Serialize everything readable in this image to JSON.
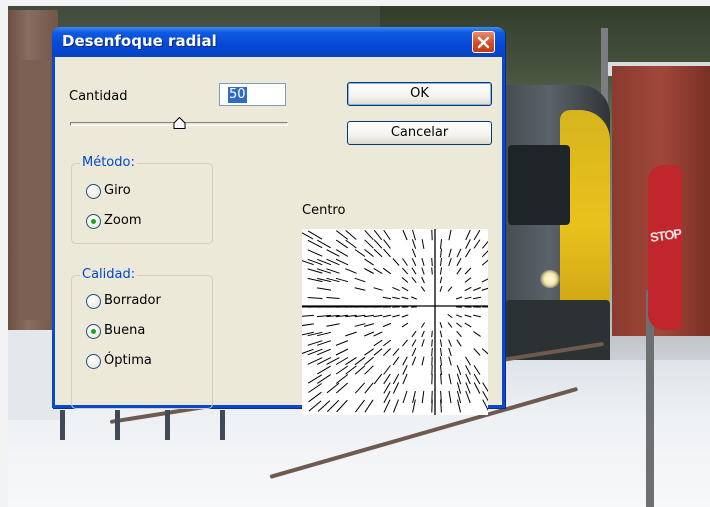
{
  "dialog": {
    "title": "Desenfoque radial",
    "close_icon": "close-x-icon"
  },
  "amount": {
    "label": "Cantidad",
    "value": "50",
    "slider_value": 50
  },
  "buttons": {
    "ok": "OK",
    "cancel": "Cancelar"
  },
  "method": {
    "legend": "Método:",
    "options": [
      {
        "label": "Giro",
        "selected": false
      },
      {
        "label": "Zoom",
        "selected": true
      }
    ]
  },
  "quality": {
    "legend": "Calidad:",
    "options": [
      {
        "label": "Borrador",
        "selected": false
      },
      {
        "label": "Buena",
        "selected": true
      },
      {
        "label": "Óptima",
        "selected": false
      }
    ]
  },
  "center": {
    "label": "Centro",
    "preview": "radial-zoom-preview"
  },
  "colors": {
    "titlebar": "#0548d6",
    "dialog_bg": "#ece9d8",
    "group_legend": "#0046d5",
    "selection": "#316ac5",
    "close_button": "#d54d28",
    "radio_dot": "#21a121"
  }
}
